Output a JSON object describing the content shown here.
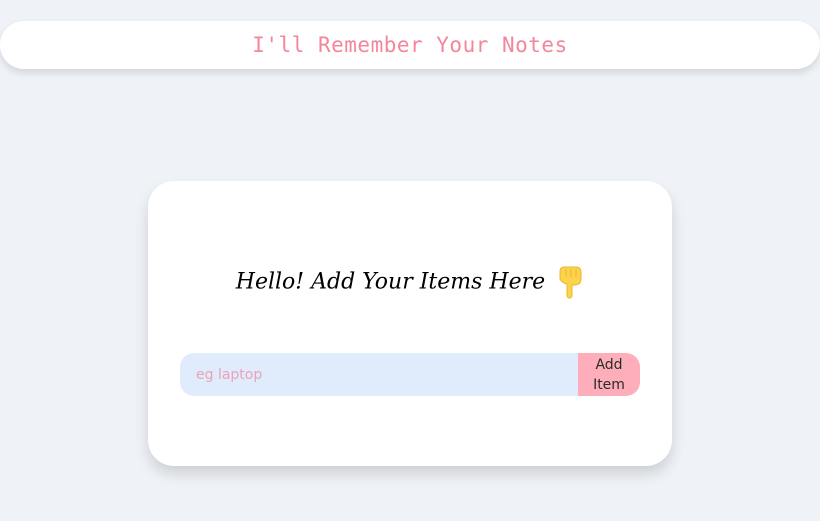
{
  "header": {
    "title": "I'll Remember Your Notes"
  },
  "card": {
    "heading": "Hello! Add Your Items Here",
    "heading_icon": "pointing-down-hand-icon",
    "input": {
      "placeholder": "eg laptop",
      "value": ""
    },
    "add_button_label": "Add Item"
  },
  "colors": {
    "background": "#eff3f7",
    "title": "#f3869b",
    "input_background": "#e0ebfb",
    "placeholder": "#eaa4b8",
    "button": "#feaebb",
    "hand_icon": "#fcd34d"
  }
}
